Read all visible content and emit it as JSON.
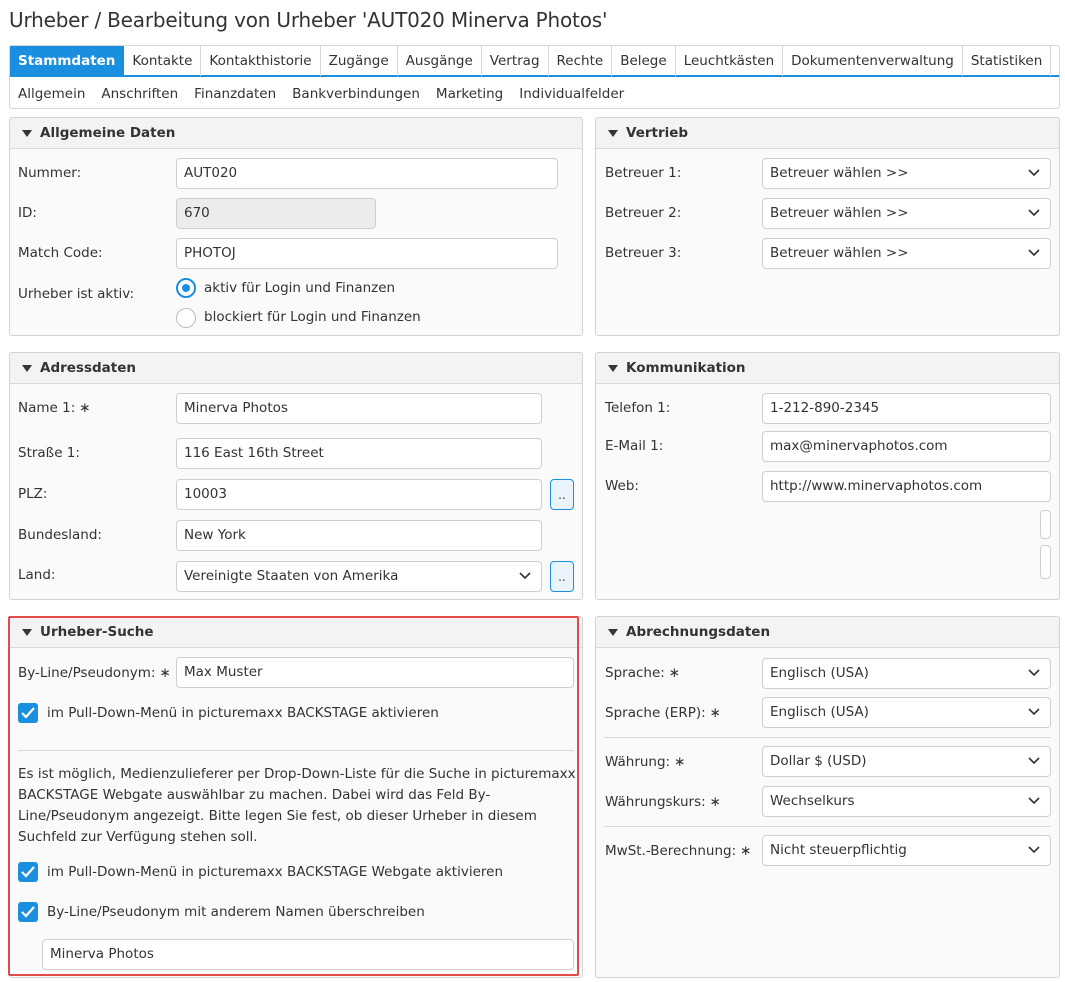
{
  "page": {
    "title": "Urheber / Bearbeitung von Urheber 'AUT020 Minerva Photos'"
  },
  "tabs": [
    "Stammdaten",
    "Kontakte",
    "Kontakthistorie",
    "Zugänge",
    "Ausgänge",
    "Vertrag",
    "Rechte",
    "Belege",
    "Leuchtkästen",
    "Dokumentenverwaltung",
    "Statistiken"
  ],
  "active_tab": "Stammdaten",
  "subtabs": [
    "Allgemein",
    "Anschriften",
    "Finanzdaten",
    "Bankverbindungen",
    "Marketing",
    "Individualfelder"
  ],
  "general": {
    "title": "Allgemeine Daten",
    "nummer_label": "Nummer:",
    "nummer_value": "AUT020",
    "id_label": "ID:",
    "id_value": "670",
    "match_label": "Match Code:",
    "match_value": "PHOTOJ",
    "aktiv_label": "Urheber ist aktiv:",
    "radio_active": "aktiv für Login und Finanzen",
    "radio_blocked": "blockiert für Login und Finanzen"
  },
  "vertrieb": {
    "title": "Vertrieb",
    "b1_label": "Betreuer 1:",
    "b2_label": "Betreuer 2:",
    "b3_label": "Betreuer 3:",
    "select_value": "Betreuer wählen >>"
  },
  "address": {
    "title": "Adressdaten",
    "name_label": "Name 1:",
    "name_value": "Minerva Photos",
    "street_label": "Straße 1:",
    "street_value": "116 East 16th Street",
    "plz_label": "PLZ:",
    "plz_value": "10003",
    "state_label": "Bundesland:",
    "state_value": "New York",
    "country_label": "Land:",
    "country_value": "Vereinigte Staaten von Amerika",
    "dots": ".."
  },
  "communication": {
    "title": "Kommunikation",
    "phone_label": "Telefon 1:",
    "phone_value": "1-212-890-2345",
    "email_label": "E-Mail 1:",
    "email_value": "max@minervaphotos.com",
    "web_label": "Web:",
    "web_value": "http://www.minervaphotos.com"
  },
  "search": {
    "title": "Urheber-Suche",
    "byline_label": "By-Line/Pseudonym:",
    "byline_value": "Max Muster",
    "check1": "im Pull-Down-Menü in picturemaxx BACKSTAGE aktivieren",
    "para": "Es ist möglich, Medienzulieferer per Drop-Down-Liste für die Suche in picturemaxx BACKSTAGE Webgate auswählbar zu machen. Dabei wird das Feld By-Line/Pseudonym angezeigt. Bitte legen Sie fest, ob dieser Urheber in diesem Suchfeld zur Verfügung stehen soll.",
    "check2": "im Pull-Down-Menü in picturemaxx BACKSTAGE Webgate aktivieren",
    "check3": "By-Line/Pseudonym mit anderem Namen überschreiben",
    "override_value": "Minerva Photos"
  },
  "billing": {
    "title": "Abrechnungsdaten",
    "lang_label": "Sprache:",
    "lang_value": "Englisch (USA)",
    "erp_label": "Sprache (ERP):",
    "erp_value": "Englisch (USA)",
    "cur_label": "Währung:",
    "cur_value": "Dollar $ (USD)",
    "rate_label": "Währungskurs:",
    "rate_value": "Wechselkurs",
    "vat_label": "MwSt.-Berechnung:",
    "vat_value": "Nicht steuerpflichtig"
  },
  "required_mark": "∗",
  "colors": {
    "accent": "#1a8fe0",
    "highlight": "#e04b4b",
    "panel_bg": "#fafafa"
  }
}
